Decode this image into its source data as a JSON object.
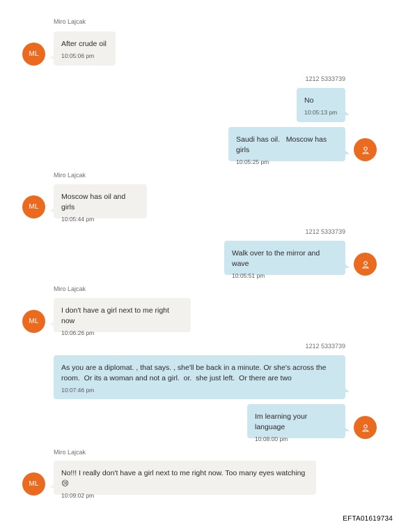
{
  "contacts": {
    "incoming_name": "Miro Lajcak",
    "incoming_initials": "ML",
    "outgoing_number": "1212 5333739"
  },
  "messages": [
    {
      "text": "After crude oil",
      "time": "10:05:06 pm"
    },
    {
      "text": "No",
      "time": "10:05:13 pm"
    },
    {
      "text": "Saudi has oil.   Moscow has girls",
      "time": "10:05:25 pm"
    },
    {
      "text": "Moscow has oil and girls",
      "time": "10:05:44 pm"
    },
    {
      "text": "Walk over to the mirror and wave",
      "time": "10:05:51 pm"
    },
    {
      "text": "I don't have a girl next to me right now",
      "time": "10:06:26 pm"
    },
    {
      "text": "As you are a diplomat. , that says. , she'll be back in a minute. Or she's across the room.  Or its a woman and not a girl.  or.  she just left.  Or there are two",
      "time": "10:07:46 pm"
    },
    {
      "text": "Im learning your language",
      "time": "10:08:00 pm"
    },
    {
      "text": "No!!! I really don't have a girl next to me right now. Too many eyes watching😢",
      "time": "10:09:02 pm"
    }
  ],
  "footer": {
    "doc_id": "EFTA01619734"
  },
  "colors": {
    "incoming_bubble": "#f3f1ee",
    "outgoing_bubble": "#cbe6ee",
    "avatar": "#ea6a1f"
  },
  "icons": {
    "outgoing_avatar": "person-icon"
  }
}
